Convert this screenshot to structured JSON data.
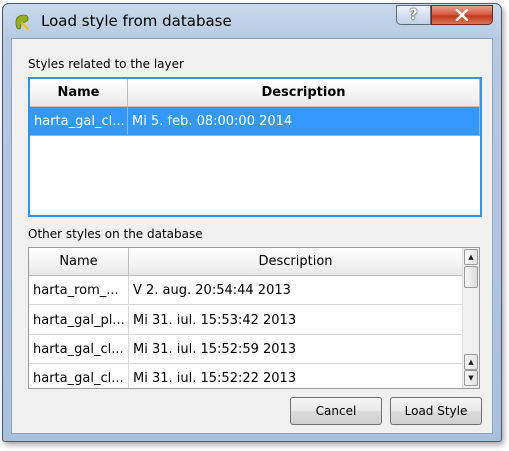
{
  "window": {
    "title": "Load style from database"
  },
  "titlebar": {
    "help_label": "?"
  },
  "layer_styles": {
    "label": "Styles related to the layer",
    "columns": [
      "Name",
      "Description"
    ],
    "rows": [
      {
        "name": "harta_gal_cl...",
        "description": "Mi 5. feb. 08:00:00 2014",
        "selected": true
      }
    ]
  },
  "other_styles": {
    "label": "Other styles on the database",
    "columns": [
      "Name",
      "Description"
    ],
    "rows": [
      {
        "name": "harta_rom_...",
        "description": "V 2. aug. 20:54:44 2013"
      },
      {
        "name": "harta_gal_pl...",
        "description": "Mi 31. iul. 15:53:42 2013"
      },
      {
        "name": "harta_gal_cl...",
        "description": "Mi 31. iul. 15:52:59 2013"
      },
      {
        "name": "harta_gal_cl...",
        "description": "Mi 31. iul. 15:52:22 2013"
      }
    ]
  },
  "buttons": {
    "cancel": "Cancel",
    "load": "Load Style"
  }
}
